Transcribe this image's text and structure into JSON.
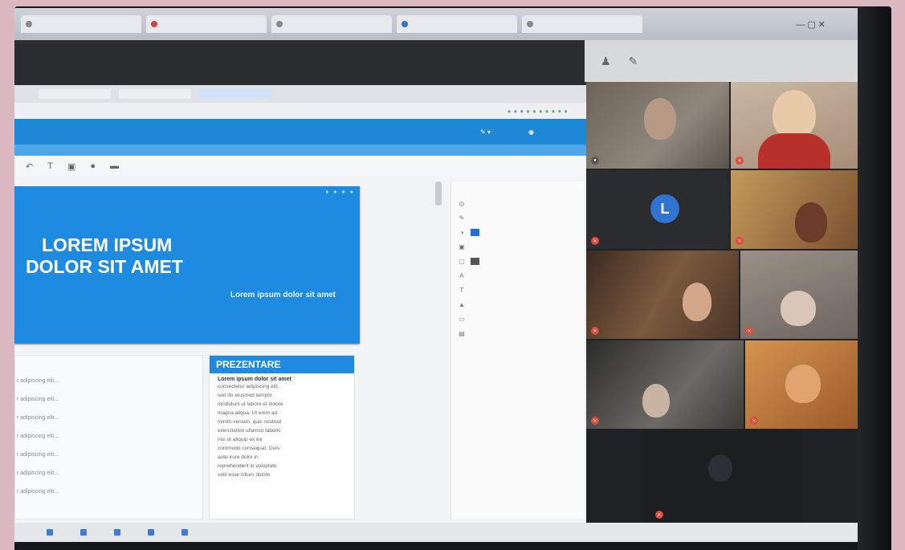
{
  "browser": {
    "tabs": [
      "",
      "",
      "",
      "",
      "",
      ""
    ]
  },
  "slide": {
    "title_line1": "LOREM IPSUM",
    "title_line2": "DOLOR SIT AMET",
    "subtitle": "Lorem ipsum dolor sit amet"
  },
  "outline": {
    "items": [
      "r adipiscing elit...",
      "r adipiscing elit...",
      "r adipiscing elit...",
      "r adipiscing elit...",
      "r adipiscing elit...",
      "r adipiscing elit...",
      "r adipiscing elit..."
    ]
  },
  "presentation": {
    "heading": "PREZENTARE",
    "lead": "Lorem ipsum dolor sit amet",
    "lines": [
      "consectetur adipiscing elit,",
      "sed do eiusmod tempor",
      "incididunt ut labore et dolore",
      "magna aliqua. Ut enim ad",
      "minim veniam, quis nostrud",
      "exercitation ullamco laboris",
      "nisi ut aliquip ex ea",
      "commodo consequat. Duis",
      "aute irure dolor in",
      "reprehenderit in voluptate",
      "velit esse cillum dolore"
    ]
  },
  "participants": {
    "tile_l_initial": "L"
  },
  "colors": {
    "accent_blue": "#1f8be0",
    "mic_off_red": "#e24b3b",
    "avatar_blue": "#2f74d1"
  }
}
